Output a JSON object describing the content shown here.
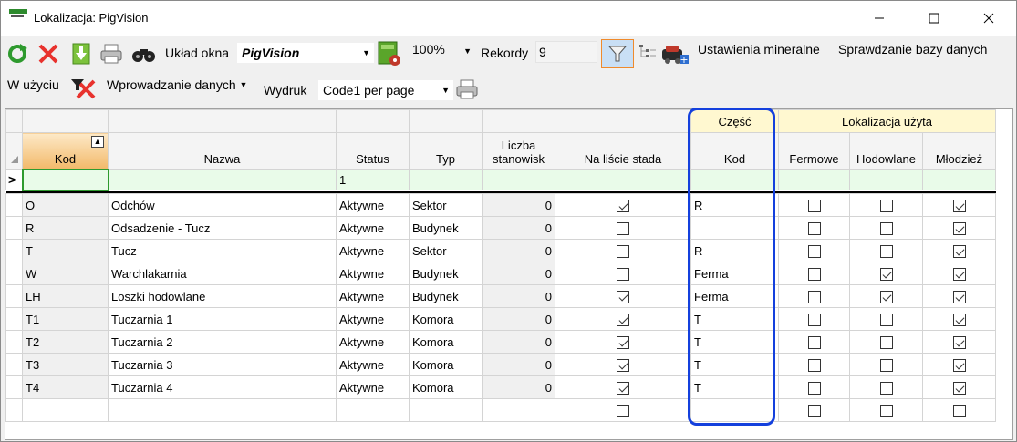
{
  "window": {
    "title": "Lokalizacja: PigVision"
  },
  "toolbar": {
    "uklad_label": "Układ okna",
    "uklad_value": "PigVision",
    "zoom_value": "100%",
    "rekordy_label": "Rekordy",
    "rekordy_value": "9",
    "ustawienia_label": "Ustawienia mineralne",
    "sprawdzanie_label": "Sprawdzanie bazy danych",
    "w_uzyciu_label": "W użyciu",
    "wprowadzanie_label": "Wprowadzanie danych",
    "wydruk_label": "Wydruk",
    "wydruk_value": "Code1 per page"
  },
  "grid": {
    "groups": {
      "czesc": "Część",
      "lokalizacja": "Lokalizacja użyta"
    },
    "columns": {
      "kod": "Kod",
      "nazwa": "Nazwa",
      "status": "Status",
      "typ": "Typ",
      "liczba1": "Liczba",
      "liczba2": "stanowisk",
      "na_liscie": "Na liście stada",
      "czesc_kod": "Kod",
      "fermowe": "Fermowe",
      "hodowlane": "Hodowlane",
      "mlodziez": "Młodzież"
    },
    "new_row": {
      "indicator": ">",
      "status": "1"
    },
    "rows": [
      {
        "kod": "O",
        "nazwa": "Odchów",
        "status": "Aktywne",
        "typ": "Sektor",
        "liczba": "0",
        "na_liscie": true,
        "czesc_kod": "R",
        "fermowe": false,
        "hodowlane": false,
        "mlodziez": true
      },
      {
        "kod": "R",
        "nazwa": "Odsadzenie - Tucz",
        "status": "Aktywne",
        "typ": "Budynek",
        "liczba": "0",
        "na_liscie": false,
        "czesc_kod": "",
        "fermowe": false,
        "hodowlane": false,
        "mlodziez": true
      },
      {
        "kod": "T",
        "nazwa": "Tucz",
        "status": "Aktywne",
        "typ": "Sektor",
        "liczba": "0",
        "na_liscie": false,
        "czesc_kod": "R",
        "fermowe": false,
        "hodowlane": false,
        "mlodziez": true
      },
      {
        "kod": "W",
        "nazwa": "Warchlakarnia",
        "status": "Aktywne",
        "typ": "Budynek",
        "liczba": "0",
        "na_liscie": false,
        "czesc_kod": "Ferma",
        "fermowe": false,
        "hodowlane": true,
        "mlodziez": true
      },
      {
        "kod": "LH",
        "nazwa": "Loszki hodowlane",
        "status": "Aktywne",
        "typ": "Budynek",
        "liczba": "0",
        "na_liscie": true,
        "czesc_kod": "Ferma",
        "fermowe": false,
        "hodowlane": true,
        "mlodziez": true
      },
      {
        "kod": "T1",
        "nazwa": "Tuczarnia 1",
        "status": "Aktywne",
        "typ": "Komora",
        "liczba": "0",
        "na_liscie": true,
        "czesc_kod": "T",
        "fermowe": false,
        "hodowlane": false,
        "mlodziez": true
      },
      {
        "kod": "T2",
        "nazwa": "Tuczarnia 2",
        "status": "Aktywne",
        "typ": "Komora",
        "liczba": "0",
        "na_liscie": true,
        "czesc_kod": "T",
        "fermowe": false,
        "hodowlane": false,
        "mlodziez": true
      },
      {
        "kod": "T3",
        "nazwa": "Tuczarnia 3",
        "status": "Aktywne",
        "typ": "Komora",
        "liczba": "0",
        "na_liscie": true,
        "czesc_kod": "T",
        "fermowe": false,
        "hodowlane": false,
        "mlodziez": true
      },
      {
        "kod": "T4",
        "nazwa": "Tuczarnia 4",
        "status": "Aktywne",
        "typ": "Komora",
        "liczba": "0",
        "na_liscie": true,
        "czesc_kod": "T",
        "fermowe": false,
        "hodowlane": false,
        "mlodziez": true
      },
      {
        "kod": "",
        "nazwa": "",
        "status": "",
        "typ": "",
        "liczba": "",
        "na_liscie": false,
        "czesc_kod": "",
        "fermowe": false,
        "hodowlane": false,
        "mlodziez": false
      }
    ]
  },
  "colors": {
    "highlight": "#1440dd",
    "new_row": "#e9fbe9",
    "group_header": "#fff8d0"
  }
}
